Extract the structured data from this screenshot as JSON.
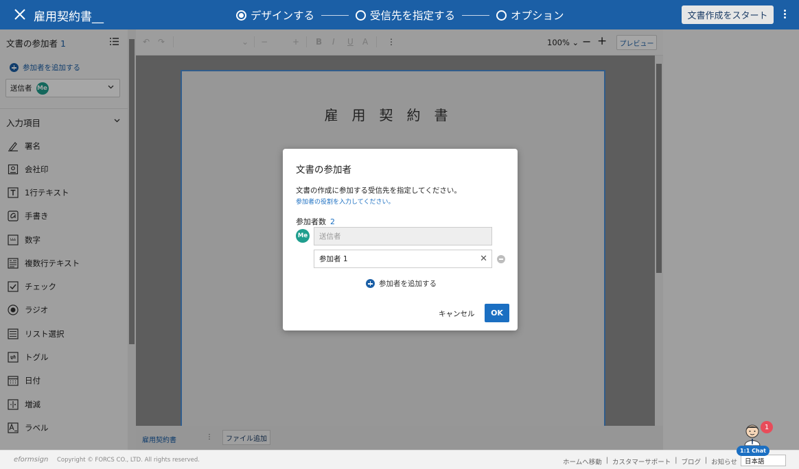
{
  "header": {
    "title": "雇用契約書__",
    "steps": [
      "デザインする",
      "受信先を指定する",
      "オプション"
    ],
    "start_button": "文書作成をスタート"
  },
  "sidebar": {
    "participants_title": "文書の参加者",
    "participants_count": "1",
    "add_participant": "参加者を追加する",
    "sender_label": "送信者",
    "me_badge": "Me",
    "fields_section": "入力項目",
    "tools": [
      "署名",
      "会社印",
      "1行テキスト",
      "手書き",
      "数字",
      "複数行テキスト",
      "チェック",
      "ラジオ",
      "リスト選択",
      "トグル",
      "日付",
      "増減",
      "ラベル"
    ]
  },
  "toolbar": {
    "zoom": "100%",
    "preview": "プレビュー"
  },
  "document": {
    "title": "雇用契約書"
  },
  "bottom": {
    "doc_tab": "雇用契約書",
    "add_file": "ファイル追加"
  },
  "footer": {
    "logo": "eformsign",
    "copyright": "Copyright © FORCS CO., LTD. All rights reserved.",
    "links": [
      "ホームへ移動",
      "カスタマーサポート",
      "ブログ",
      "お知らせ"
    ],
    "language": "日本語"
  },
  "modal": {
    "title": "文書の参加者",
    "description": "文書の作成に参加する受信先を指定してください。",
    "role_link": "参加者の役割を入力してください。",
    "count_label": "参加者数",
    "count": "2",
    "me_badge": "Me",
    "sender_placeholder": "送信者",
    "participant1_value": "参加者 1",
    "add_participant": "参加者を追加する",
    "cancel": "キャンセル",
    "ok": "OK"
  },
  "chat": {
    "label": "1:1 Chat",
    "badge": "1"
  }
}
